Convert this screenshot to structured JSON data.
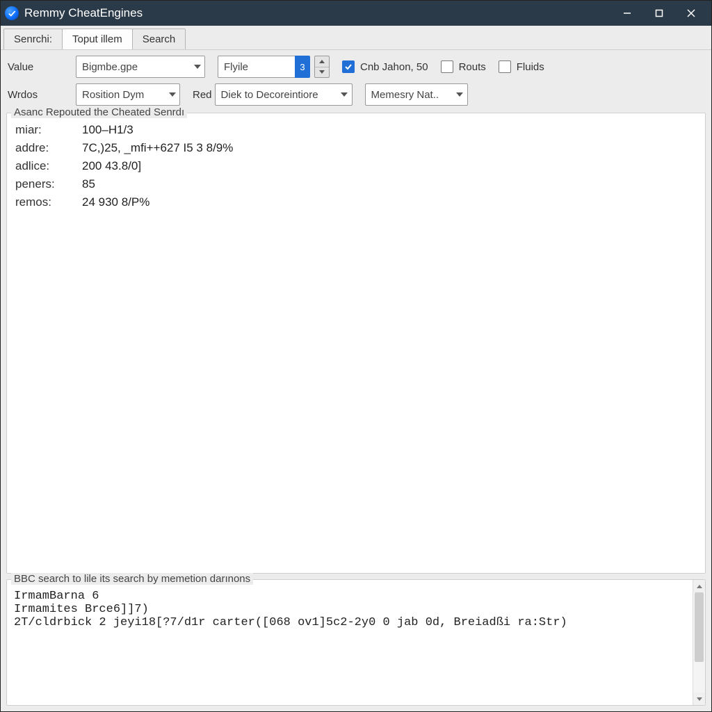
{
  "window": {
    "title": "Remmy CheatEngines"
  },
  "tabs": [
    "Senrchi:",
    "Toput illem",
    "Search"
  ],
  "toolbar": {
    "row1": {
      "label": "Value",
      "combo1": "Bigmbe.gpe",
      "combo2": "Flyile",
      "numBadge": "3",
      "chk1": "Cnb Jahon, 50",
      "chk2": "Routs",
      "chk3": "Fluids"
    },
    "row2": {
      "label": "Wrdos",
      "combo1": "Rosition Dym",
      "redLabel": "Red",
      "combo2": "Diek to Decoreintiore",
      "combo3": "Memesry Nat.."
    }
  },
  "group1": {
    "legend": "Asanc Repouted the Cheated Senrdı",
    "rows": [
      {
        "k": "miar:",
        "v": "100–H1/3"
      },
      {
        "k": "addre:",
        "v": "7C,)25, _mfi++627 I5 3 8/9%"
      },
      {
        "k": "adlice:",
        "v": "200 43.8/0]"
      },
      {
        "k": "peners:",
        "v": "85"
      },
      {
        "k": "remos:",
        "v": "24 930 8/P%"
      }
    ]
  },
  "group2": {
    "legend": "BBC search to lile its search by memetion darınons",
    "lines": [
      "IrmamBarna 6",
      "Irmamites Brce6]]7)",
      "2T/cldrbick 2 jeyi18[?7/d1r carter([068 ov1]5c2-2y0 0 jab 0d, Breiadßi ra:Str)"
    ]
  }
}
